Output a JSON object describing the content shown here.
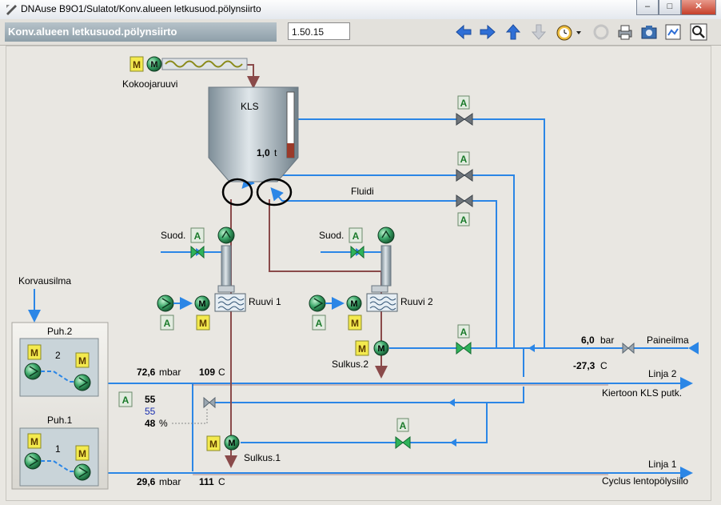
{
  "window": {
    "title": "DNAuse B9O1/Sulatot/Konv.alueen letkusuod.pölynsiirto",
    "minimize": "–",
    "maximize": "□",
    "close": "✕"
  },
  "header": {
    "title": "Konv.alueen letkusuod.pölynsiirto",
    "address": "1.50.15"
  },
  "toolbar": [
    "back-icon",
    "forward-icon",
    "up-icon",
    "down-icon",
    "clock-icon",
    "refresh-icon",
    "print-icon",
    "camera-icon",
    "screenshot-icon",
    "zoom-icon"
  ],
  "labels": {
    "kokoojaruuvi": "Kokoojaruuvi",
    "kls": "KLS",
    "fluidi": "Fluidi",
    "suod1": "Suod.",
    "suod2": "Suod.",
    "ruuvi1": "Ruuvi 1",
    "ruuvi2": "Ruuvi 2",
    "korvausilma": "Korvausilma",
    "puh2": "Puh.2",
    "puh1": "Puh.1",
    "puh2_num": "2",
    "puh1_num": "1",
    "sulkus2": "Sulkus.2",
    "sulkus1": "Sulkus.1",
    "paineilma": "Paineilma",
    "linja2": "Linja 2",
    "kiertoon": "Kiertoon KLS putk.",
    "linja1": "Linja 1",
    "cyclus": "Cyclus lentopölysiilo"
  },
  "values": {
    "kls_level": "1,0",
    "kls_unit": "t",
    "pressure_bar": "6,0",
    "pressure_bar_unit": "bar",
    "temp_air": "-27,3",
    "temp_air_unit": "C",
    "l2_pressure": "72,6",
    "l2_pressure_unit": "mbar",
    "l2_temp": "109",
    "l2_temp_unit": "C",
    "l1_pressure": "29,6",
    "l1_pressure_unit": "mbar",
    "l1_temp": "111",
    "l1_temp_unit": "C",
    "valve_sp": "55",
    "valve_pv": "55",
    "valve_out": "48",
    "valve_out_unit": "%"
  },
  "badges": {
    "m": "M",
    "a": "A"
  },
  "colors": {
    "air": "#2b86e6",
    "dust": "#8a4a4a",
    "motor": "#2f9a5a",
    "badge": "#f4ea4e",
    "badge_a": "#e2ece0"
  },
  "tank_fill": 0.22
}
